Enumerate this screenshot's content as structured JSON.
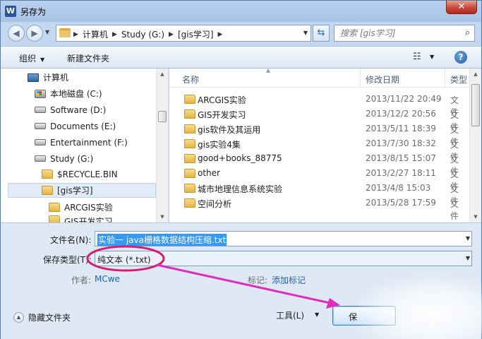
{
  "window": {
    "title": "另存为",
    "app_icon_letter": "W",
    "close_glyph": "✕"
  },
  "address": {
    "crumbs": [
      "计算机",
      "Study (G:)",
      "[gis学习]"
    ]
  },
  "search": {
    "placeholder": "搜索 [gis学习]"
  },
  "toolbar": {
    "organize_label": "组织",
    "new_folder_label": "新建文件夹",
    "help_glyph": "?"
  },
  "nav_tree": [
    {
      "label": "计算机",
      "icon": "computer-icon"
    },
    {
      "label": "本地磁盘 (C:)",
      "icon": "windows-drive-icon"
    },
    {
      "label": "Software (D:)",
      "icon": "drive-icon"
    },
    {
      "label": "Documents (E:)",
      "icon": "drive-icon"
    },
    {
      "label": "Entertainment (F:)",
      "icon": "drive-icon"
    },
    {
      "label": "Study (G:)",
      "icon": "drive-icon"
    },
    {
      "label": "$RECYCLE.BIN",
      "icon": "folder-icon"
    },
    {
      "label": "[gis学习]",
      "icon": "folder-icon",
      "selected": true
    },
    {
      "label": "ARCGIS实验",
      "icon": "folder-icon"
    },
    {
      "label": "GIS开发实习",
      "icon": "folder-icon"
    }
  ],
  "columns": {
    "name": "名称",
    "modified": "修改日期",
    "type": "类型"
  },
  "files": [
    {
      "name": "ARCGIS实验",
      "modified": "2013/11/22 20:49",
      "type": "文件"
    },
    {
      "name": "GIS开发实习",
      "modified": "2013/12/2 20:56",
      "type": "文件"
    },
    {
      "name": "gis软件及其运用",
      "modified": "2013/5/11 18:39",
      "type": "文件"
    },
    {
      "name": "gis实验4集",
      "modified": "2013/7/30 18:32",
      "type": "文件"
    },
    {
      "name": "good+books_88775",
      "modified": "2013/8/15 15:07",
      "type": "文件"
    },
    {
      "name": "other",
      "modified": "2013/2/27 18:11",
      "type": "文件"
    },
    {
      "name": "城市地理信息系统实验",
      "modified": "2013/4/8 15:03",
      "type": "文件"
    },
    {
      "name": "空间分析",
      "modified": "2013/5/28 17:59",
      "type": "文件"
    }
  ],
  "save_form": {
    "filename_label": "文件名(N):",
    "filename_value": "实验一 java栅格数据结构压缩.txt",
    "savetype_label": "保存类型(T):",
    "savetype_value": "纯文本 (*.txt)",
    "author_label": "作者:",
    "author_value": "MCwe",
    "tags_label": "标记:",
    "tags_value": "添加标记"
  },
  "footer": {
    "hide_folders_label": "隐藏文件夹",
    "tools_label": "工具(L)",
    "save_button_label": "保"
  },
  "colors": {
    "annotation": "#d4206c",
    "selection": "#3399ff",
    "link": "#1e62b6"
  }
}
